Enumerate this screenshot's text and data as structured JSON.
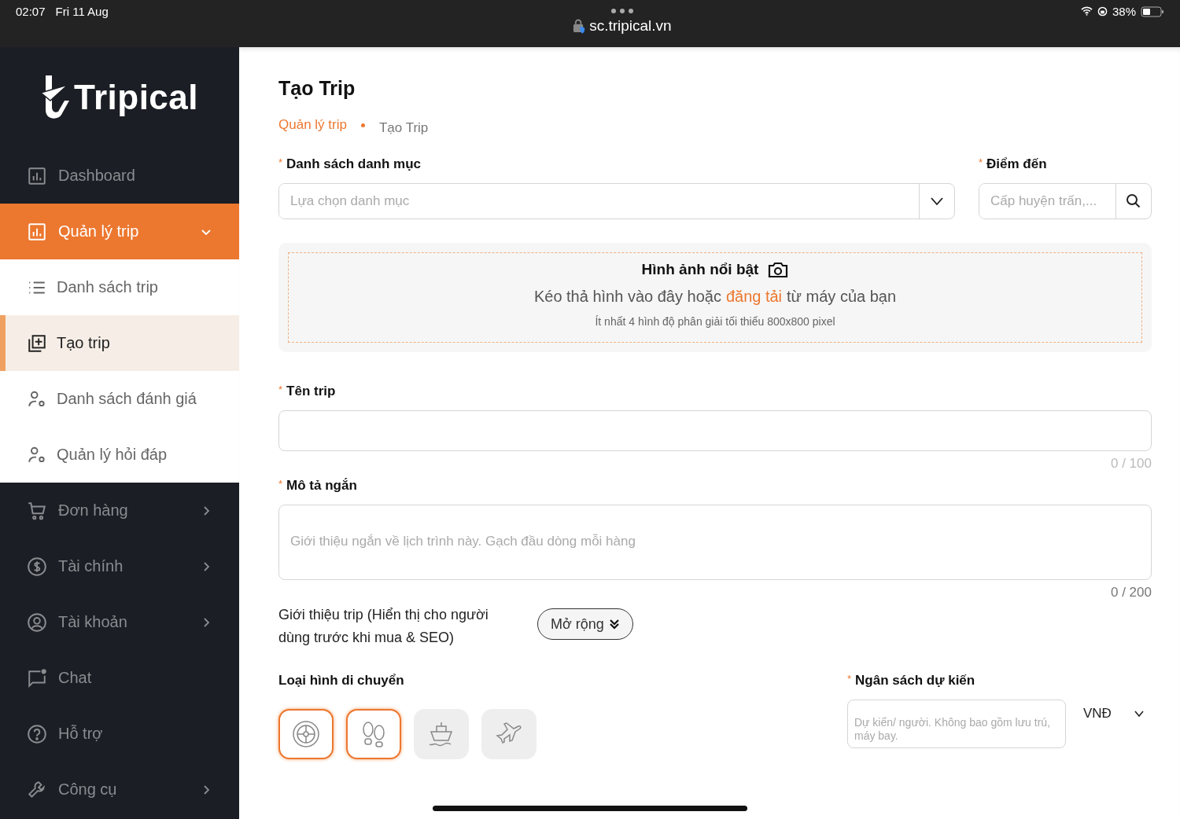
{
  "status_bar": {
    "time": "02:07",
    "date": "Fri 11 Aug",
    "url": "sc.tripical.vn",
    "battery": "38%"
  },
  "sidebar": {
    "logo": "Tripical",
    "items": [
      {
        "label": "Dashboard",
        "selected": false
      },
      {
        "label": "Quản lý trip",
        "selected": true,
        "expanded": true,
        "children": [
          {
            "label": "Danh sách trip",
            "selected": false
          },
          {
            "label": "Tạo trip",
            "selected": true
          },
          {
            "label": "Danh sách đánh giá",
            "selected": false
          },
          {
            "label": "Quản lý hỏi đáp",
            "selected": false
          }
        ]
      },
      {
        "label": "Đơn hàng",
        "selected": false,
        "expanded": false
      },
      {
        "label": "Tài chính",
        "selected": false,
        "expanded": false
      },
      {
        "label": "Tài khoản",
        "selected": false,
        "expanded": false
      },
      {
        "label": "Chat",
        "selected": false
      },
      {
        "label": "Hỗ trợ",
        "selected": false
      },
      {
        "label": "Công cụ",
        "selected": false,
        "expanded": false
      }
    ]
  },
  "page": {
    "title": "Tạo Trip",
    "breadcrumb": [
      {
        "label": "Quản lý trip",
        "selected": false
      },
      {
        "label": "Tạo Trip",
        "selected": true
      }
    ]
  },
  "form": {
    "category": {
      "label": "Danh sách danh mục",
      "required_mark": "*",
      "placeholder": "Lựa chọn danh mục"
    },
    "destination": {
      "label": "Điểm đến",
      "required_mark": "*",
      "placeholder": "Cấp huyện trấn,..."
    },
    "featured_images": {
      "title": "Hình ảnh nổi bật",
      "hint_before": "Kéo thả hình vào đây hoặc",
      "upload_link": "đăng tải",
      "hint_after": "từ máy của bạn",
      "note": "Ít nhất 4 hình độ phân giải tối thiểu 800x800 pixel"
    },
    "trip_name": {
      "label": "Tên trip",
      "required_mark": "*",
      "counter": "0 / 100"
    },
    "short_description": {
      "label": "Mô tả ngắn",
      "required_mark": "*",
      "placeholder": "Giới thiệu ngắn về lịch trình này. Gạch đầu dòng mỗi hàng",
      "counter": "0 / 200"
    },
    "introduction": {
      "label": "Giới thiệu trip (Hiển thị cho người dùng trước khi mua & SEO)",
      "expand_button": "Mở rộng"
    },
    "transport": {
      "label": "Loại hình di chuyển",
      "options": [
        {
          "kind": "wheel",
          "selected": true
        },
        {
          "kind": "walk",
          "selected": true
        },
        {
          "kind": "ship",
          "selected": false
        },
        {
          "kind": "plane",
          "selected": false
        }
      ]
    },
    "budget": {
      "label": "Ngân sách dự kiến",
      "required_mark": "*",
      "placeholder": "Dự kiến/ người. Không bao gồm lưu trú, máy bay.",
      "currency": "VNĐ"
    }
  }
}
